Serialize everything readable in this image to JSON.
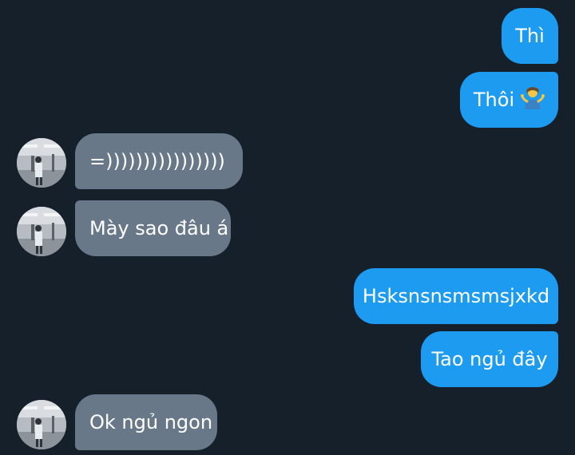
{
  "chat": {
    "messages": [
      {
        "side": "outgoing",
        "text": "Thì"
      },
      {
        "side": "outgoing",
        "text": "Thôi",
        "emoji": "shrug-emoji"
      },
      {
        "side": "incoming",
        "text": "=))))))))))))))))"
      },
      {
        "side": "incoming",
        "text": "Mày sao đâu á"
      },
      {
        "side": "outgoing",
        "text": "Hsksnsnsmsmsjxkd"
      },
      {
        "side": "outgoing",
        "text": "Tao ngủ đây"
      },
      {
        "side": "incoming",
        "text": "Ok ngủ ngon"
      }
    ]
  },
  "colors": {
    "background": "#15202b",
    "outgoing_bubble": "#1d9bf0",
    "incoming_bubble": "#687889",
    "text": "#ffffff"
  }
}
